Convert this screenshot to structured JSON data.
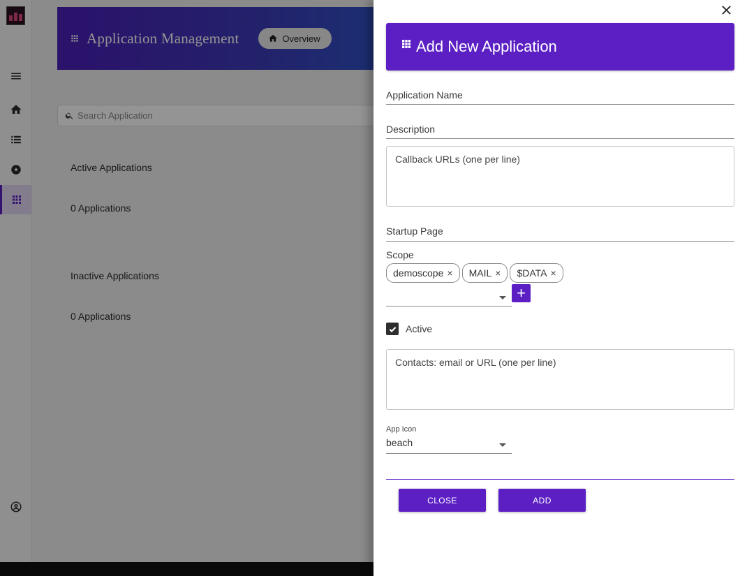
{
  "app": {
    "header_title": "Application Management",
    "overview_label": "Overview",
    "search_placeholder": "Search Application",
    "active_heading": "Active Applications",
    "active_count": "0 Applications",
    "inactive_heading": "Inactive Applications",
    "inactive_count": "0 Applications"
  },
  "sidebar": {
    "icons": [
      "menu-icon",
      "home-icon",
      "list-icon",
      "disc-icon",
      "apps-grid-icon",
      "account-circle-icon"
    ],
    "active_item": "apps-grid-icon"
  },
  "dialog": {
    "title": "Add New Application",
    "name_label": "Application Name",
    "description_label": "Description",
    "callback_placeholder": "Callback URLs (one per line)",
    "startup_label": "Startup Page",
    "scope_label": "Scope",
    "scopes": [
      "demoscope",
      "MAIL",
      "$DATA"
    ],
    "chip_remove_glyph": "×",
    "add_scope_glyph": "+",
    "active_label": "Active",
    "active_checked": true,
    "contacts_placeholder": "Contacts: email or URL (one per line)",
    "app_icon_label": "App Icon",
    "app_icon_value": "beach",
    "close_label": "CLOSE",
    "add_label": "ADD"
  },
  "colors": {
    "accent": "#5b1fc4",
    "header_gradient_start": "#4b1fb8",
    "header_gradient_end": "#2f52c4"
  }
}
